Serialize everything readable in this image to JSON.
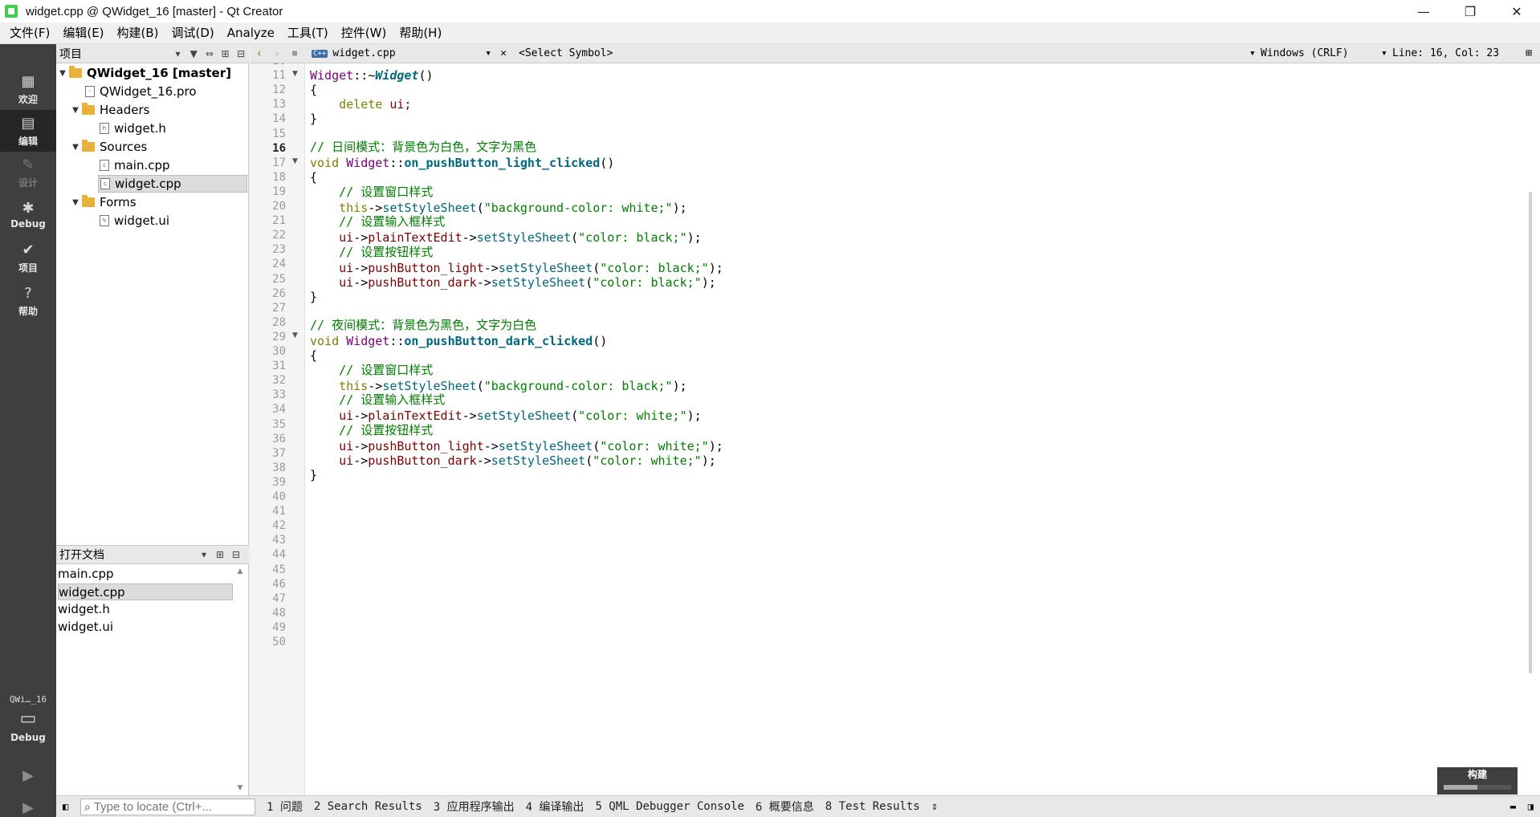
{
  "window": {
    "title": "widget.cpp @ QWidget_16 [master] - Qt Creator",
    "controls": {
      "minimize": "—",
      "restore": "❐",
      "close": "✕"
    }
  },
  "menu": [
    "文件(F)",
    "编辑(E)",
    "构建(B)",
    "调试(D)",
    "Analyze",
    "工具(T)",
    "控件(W)",
    "帮助(H)"
  ],
  "modes": [
    {
      "label": "欢迎",
      "icon": "grid-icon"
    },
    {
      "label": "编辑",
      "icon": "edit-icon",
      "active": true
    },
    {
      "label": "设计",
      "icon": "pencil-icon",
      "disabled": true
    },
    {
      "label": "Debug",
      "icon": "bug-icon"
    },
    {
      "label": "项目",
      "icon": "wrench-icon"
    },
    {
      "label": "帮助",
      "icon": "help-icon"
    }
  ],
  "kit": {
    "name": "QWi…_16",
    "config": "Debug"
  },
  "project_panel": {
    "combo": "项目",
    "tree": [
      {
        "label": "QWidget_16 [master]",
        "bold": true,
        "type": "project"
      },
      {
        "label": "QWidget_16.pro",
        "type": "pro"
      },
      {
        "label": "Headers",
        "type": "folder"
      },
      {
        "label": "widget.h",
        "type": "h"
      },
      {
        "label": "Sources",
        "type": "folder"
      },
      {
        "label": "main.cpp",
        "type": "cpp"
      },
      {
        "label": "widget.cpp",
        "type": "cpp",
        "selected": true
      },
      {
        "label": "Forms",
        "type": "folder"
      },
      {
        "label": "widget.ui",
        "type": "ui"
      }
    ]
  },
  "open_docs": {
    "title": "打开文档",
    "items": [
      "main.cpp",
      "widget.cpp",
      "widget.h",
      "widget.ui"
    ],
    "selected": 1
  },
  "editor_toolbar": {
    "file": "widget.cpp",
    "symbol": "<Select Symbol>",
    "encoding": "Windows (CRLF)",
    "position": "Line: 16, Col: 23"
  },
  "editor": {
    "current_line": 16,
    "first_line": 10,
    "last_line": 50,
    "fold_lines": [
      11,
      17,
      29
    ]
  },
  "code": {
    "l11": [
      "Widget",
      "::~",
      "Widget",
      "()"
    ],
    "l12": "{",
    "l13": [
      "    ",
      "delete",
      " ui;"
    ],
    "l14": "}",
    "l16": "// 日间模式：背景色为白色，文字为黑色",
    "l17": [
      "void",
      " ",
      "Widget",
      "::",
      "on_pushButton_light_clicked",
      "()"
    ],
    "l18": "{",
    "l19": "    // 设置窗口样式",
    "l20": [
      "    ",
      "this",
      "->",
      "setStyleSheet",
      "(",
      "\"background-color: white;\"",
      ");"
    ],
    "l21": "    // 设置输入框样式",
    "l22": [
      "    ",
      "ui",
      "->",
      "plainTextEdit",
      "->",
      "setStyleSheet",
      "(",
      "\"color: black;\"",
      ");"
    ],
    "l23": "    // 设置按钮样式",
    "l24": [
      "    ",
      "ui",
      "->",
      "pushButton_light",
      "->",
      "setStyleSheet",
      "(",
      "\"color: black;\"",
      ");"
    ],
    "l25": [
      "    ",
      "ui",
      "->",
      "pushButton_dark",
      "->",
      "setStyleSheet",
      "(",
      "\"color: black;\"",
      ");"
    ],
    "l26": "}",
    "l28": "// 夜间模式：背景色为黑色，文字为白色",
    "l29": [
      "void",
      " ",
      "Widget",
      "::",
      "on_pushButton_dark_clicked",
      "()"
    ],
    "l30": "{",
    "l31": "    // 设置窗口样式",
    "l32": [
      "    ",
      "this",
      "->",
      "setStyleSheet",
      "(",
      "\"background-color: black;\"",
      ");"
    ],
    "l33": "    // 设置输入框样式",
    "l34": [
      "    ",
      "ui",
      "->",
      "plainTextEdit",
      "->",
      "setStyleSheet",
      "(",
      "\"color: white;\"",
      ");"
    ],
    "l35": "    // 设置按钮样式",
    "l36": [
      "    ",
      "ui",
      "->",
      "pushButton_light",
      "->",
      "setStyleSheet",
      "(",
      "\"color: white;\"",
      ");"
    ],
    "l37": [
      "    ",
      "ui",
      "->",
      "pushButton_dark",
      "->",
      "setStyleSheet",
      "(",
      "\"color: white;\"",
      ");"
    ],
    "l38": "}"
  },
  "build_box": {
    "label": "构建",
    "progress": 0.5
  },
  "statusbar": {
    "locator_placeholder": "Type to locate (Ctrl+...",
    "items": [
      "1 问题",
      "2 Search Results",
      "3 应用程序输出",
      "4 编译输出",
      "5 QML Debugger Console",
      "6 概要信息",
      "8 Test Results"
    ]
  }
}
